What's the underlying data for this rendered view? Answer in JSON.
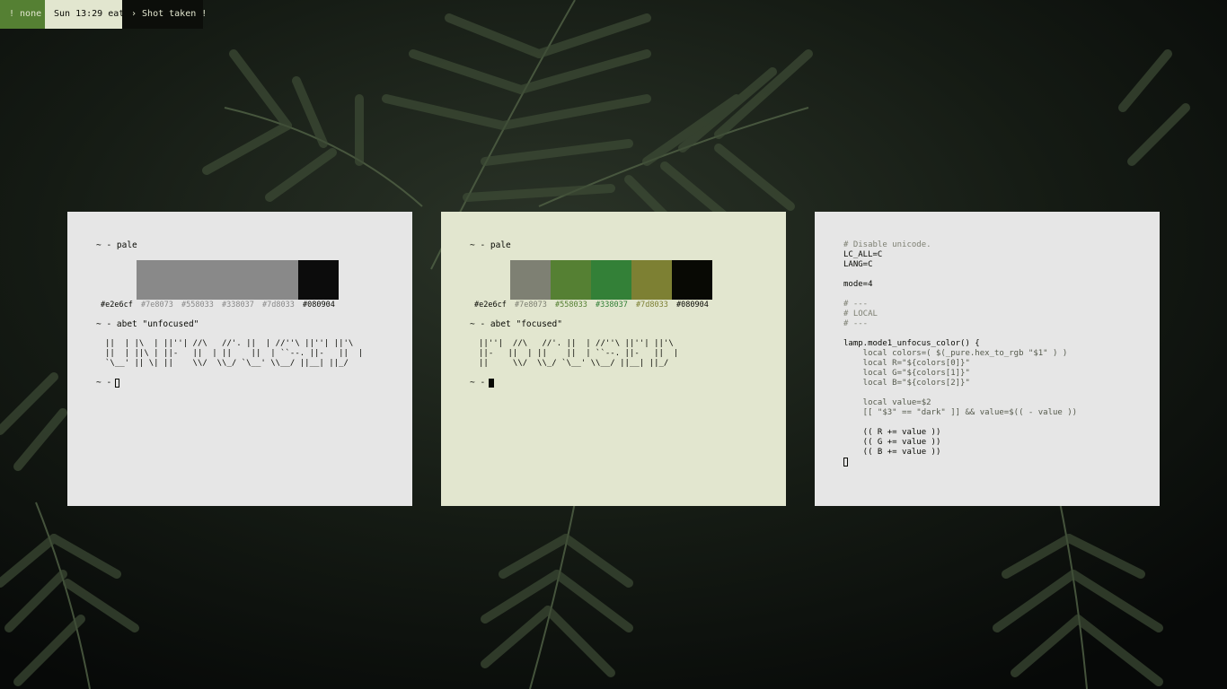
{
  "bar": {
    "tag": "! none",
    "clock": "Sun 13:29 eat",
    "message": "› Shot taken !"
  },
  "colors": {
    "bg": "#e2e6cf",
    "c1": "#7e8073",
    "c2": "#558033",
    "c3": "#338037",
    "c4": "#7d8033",
    "fg": "#080904",
    "unfocus_gray": "#898989"
  },
  "unfocused": {
    "prompt_pale": "~ - pale",
    "swatch_labels": [
      "#e2e6cf",
      "#7e8073",
      "#558033",
      "#338037",
      "#7d8033",
      "#080904"
    ],
    "prompt_abet": "~ - abet \"unfocused\"",
    "art": [
      "||  | |\\  | ||''| //\\   //'. ||  | //''\\ ||''| ||'\\",
      "||  | ||\\ | ||-   ||  | ||    ||  | ``--. ||-   ||  |",
      "`\\__' || \\| ||    \\\\/  \\\\_/ `\\__' \\\\__/ ||__| ||_/"
    ],
    "prompt_final": "~ -"
  },
  "focused": {
    "prompt_pale": "~ - pale",
    "swatch_labels": [
      "#e2e6cf",
      "#7e8073",
      "#558033",
      "#338037",
      "#7d8033",
      "#080904"
    ],
    "prompt_abet": "~ - abet \"focused\"",
    "art": [
      "||''|  //\\   //'. ||  | //''\\ ||''| ||'\\",
      "||-   ||  | ||    ||  | ``--. ||-   ||  |",
      "||     \\\\/  \\\\_/ `\\__' \\\\__/ ||__| ||_/"
    ],
    "prompt_final": "~ -"
  },
  "code": {
    "lines": [
      {
        "t": "# Disable unicode.",
        "k": "comment"
      },
      {
        "t": "LC_ALL=C",
        "k": "key"
      },
      {
        "t": "LANG=C",
        "k": "key"
      },
      {
        "t": "",
        "k": "key"
      },
      {
        "t": "mode=4",
        "k": "key"
      },
      {
        "t": "",
        "k": "key"
      },
      {
        "t": "# ---",
        "k": "comment"
      },
      {
        "t": "# LOCAL",
        "k": "comment"
      },
      {
        "t": "# ---",
        "k": "comment"
      },
      {
        "t": "",
        "k": "key"
      },
      {
        "t": "lamp.mode1_unfocus_color() {",
        "k": "key"
      },
      {
        "t": "    local colors=( $(_pure.hex_to_rgb \"$1\" ) )",
        "k": "dim"
      },
      {
        "t": "    local R=\"${colors[0]}\"",
        "k": "dim"
      },
      {
        "t": "    local G=\"${colors[1]}\"",
        "k": "dim"
      },
      {
        "t": "    local B=\"${colors[2]}\"",
        "k": "dim"
      },
      {
        "t": "",
        "k": "key"
      },
      {
        "t": "    local value=$2",
        "k": "dim"
      },
      {
        "t": "    [[ \"$3\" == \"dark\" ]] && value=$(( - value ))",
        "k": "dim"
      },
      {
        "t": "",
        "k": "key"
      },
      {
        "t": "    (( R += value ))",
        "k": "key"
      },
      {
        "t": "    (( G += value ))",
        "k": "key"
      },
      {
        "t": "    (( B += value ))",
        "k": "key"
      }
    ]
  }
}
